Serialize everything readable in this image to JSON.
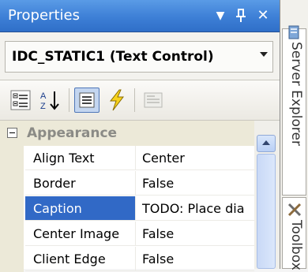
{
  "panel": {
    "title": "Properties",
    "buttons": {
      "dropdown": "▼",
      "pin": "⊥",
      "close": "✕"
    }
  },
  "object_selector": {
    "value": "IDC_STATIC1 (Text Control)"
  },
  "toolbar": {
    "tools": [
      "categorized-icon",
      "alphabetical-icon",
      "properties-icon",
      "events-icon",
      "property-pages-icon"
    ],
    "active": "properties-icon"
  },
  "grid": {
    "category": "Appearance",
    "rows": [
      {
        "name": "Align Text",
        "value": "Center"
      },
      {
        "name": "Border",
        "value": "False"
      },
      {
        "name": "Caption",
        "value": "TODO: Place dia"
      },
      {
        "name": "Center Image",
        "value": "False"
      },
      {
        "name": "Client Edge",
        "value": "False"
      }
    ],
    "selected_index": 2
  },
  "side_tabs": [
    "Server Explorer",
    "Toolbox"
  ],
  "colors": {
    "title_blue": "#3d7fd6",
    "selection_blue": "#3169c6"
  }
}
